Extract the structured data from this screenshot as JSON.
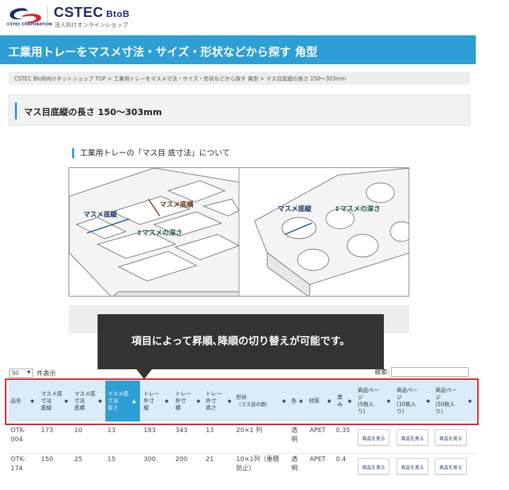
{
  "header": {
    "corp_label": "CSTEC CORPORATION",
    "brand": "CSTEC",
    "brand_suffix": "BtoB",
    "brand_sub": "法人向けオンラインショップ"
  },
  "banner": {
    "title": "工業用トレーをマスメ寸法・サイズ・形状などから探す 角型"
  },
  "breadcrumb": "CSTEC BtoB向けネットショップ TOP > 工業用トレーをマスメ寸法・サイズ・形状などから探す 角型 > マス目底縦の長さ 150～303mm",
  "section": {
    "title": "マス目底縦の長さ 150～303mm"
  },
  "diagram": {
    "title": "工業用トレーの「マス目 底寸法」について",
    "left_labels": {
      "length": "マスメ底縦",
      "width": "マスメ底横",
      "depth": "マスメの深さ"
    },
    "right_labels": {
      "length": "マスメ底縦",
      "depth": "マスメの深さ"
    }
  },
  "callout": {
    "text": "項目によって昇順､降順の切り替えが可能です。"
  },
  "controls": {
    "page_length": "50",
    "page_length_label": "件表示",
    "search_label": "検索:"
  },
  "table": {
    "headers": [
      {
        "l1": "品名",
        "l2": "",
        "l3": ""
      },
      {
        "l1": "マスメ底",
        "l2": "寸法",
        "l3": "底縦"
      },
      {
        "l1": "マスメ底",
        "l2": "寸法",
        "l3": "底横"
      },
      {
        "l1": "マスメ底",
        "l2": "寸法",
        "l3": "深さ"
      },
      {
        "l1": "トレー",
        "l2": "外寸",
        "l3": "縦"
      },
      {
        "l1": "トレー",
        "l2": "外寸",
        "l3": "横"
      },
      {
        "l1": "トレー",
        "l2": "外寸",
        "l3": "高さ"
      },
      {
        "l1": "形状",
        "l2": "（マス目の数）",
        "l3": ""
      },
      {
        "l1": "色",
        "l2": "",
        "l3": ""
      },
      {
        "l1": "材質",
        "l2": "",
        "l3": ""
      },
      {
        "l1": "厚",
        "l2": "み",
        "l3": ""
      },
      {
        "l1": "商品ペー",
        "l2": "ジ",
        "l3": "(5枚入",
        "l4": "り)"
      },
      {
        "l1": "商品ペー",
        "l2": "ジ",
        "l3": "(10枚入",
        "l4": "り)"
      },
      {
        "l1": "商品ペー",
        "l2": "ジ",
        "l3": "(50枚入",
        "l4": "り)"
      }
    ],
    "sort_glyph": "◆",
    "sort_active_glyph": "▲",
    "rows": [
      {
        "name1": "OTK-",
        "name2": "004",
        "bottom_len": "173",
        "bottom_wid": "10",
        "depth": "13",
        "outer_len": "183",
        "outer_wid": "343",
        "outer_h": "13",
        "shape1": "20×1 列",
        "shape2": "",
        "color1": "透",
        "color2": "明",
        "material": "APET",
        "thickness": "0.35",
        "btn": "商品を見る"
      },
      {
        "name1": "OTK-",
        "name2": "174",
        "bottom_len": "150",
        "bottom_wid": "25",
        "depth": "15",
        "outer_len": "300",
        "outer_wid": "200",
        "outer_h": "21",
        "shape1": "10×1列（重積",
        "shape2": "防止）",
        "color1": "透",
        "color2": "明",
        "material": "APET",
        "thickness": "0.4",
        "btn": "商品を見る"
      }
    ]
  },
  "colors": {
    "accent": "#2d9fd4",
    "brand": "#1b2a6b",
    "logo_red": "#d7262b",
    "highlight_frame": "#e0161b",
    "callout": "#333333"
  }
}
